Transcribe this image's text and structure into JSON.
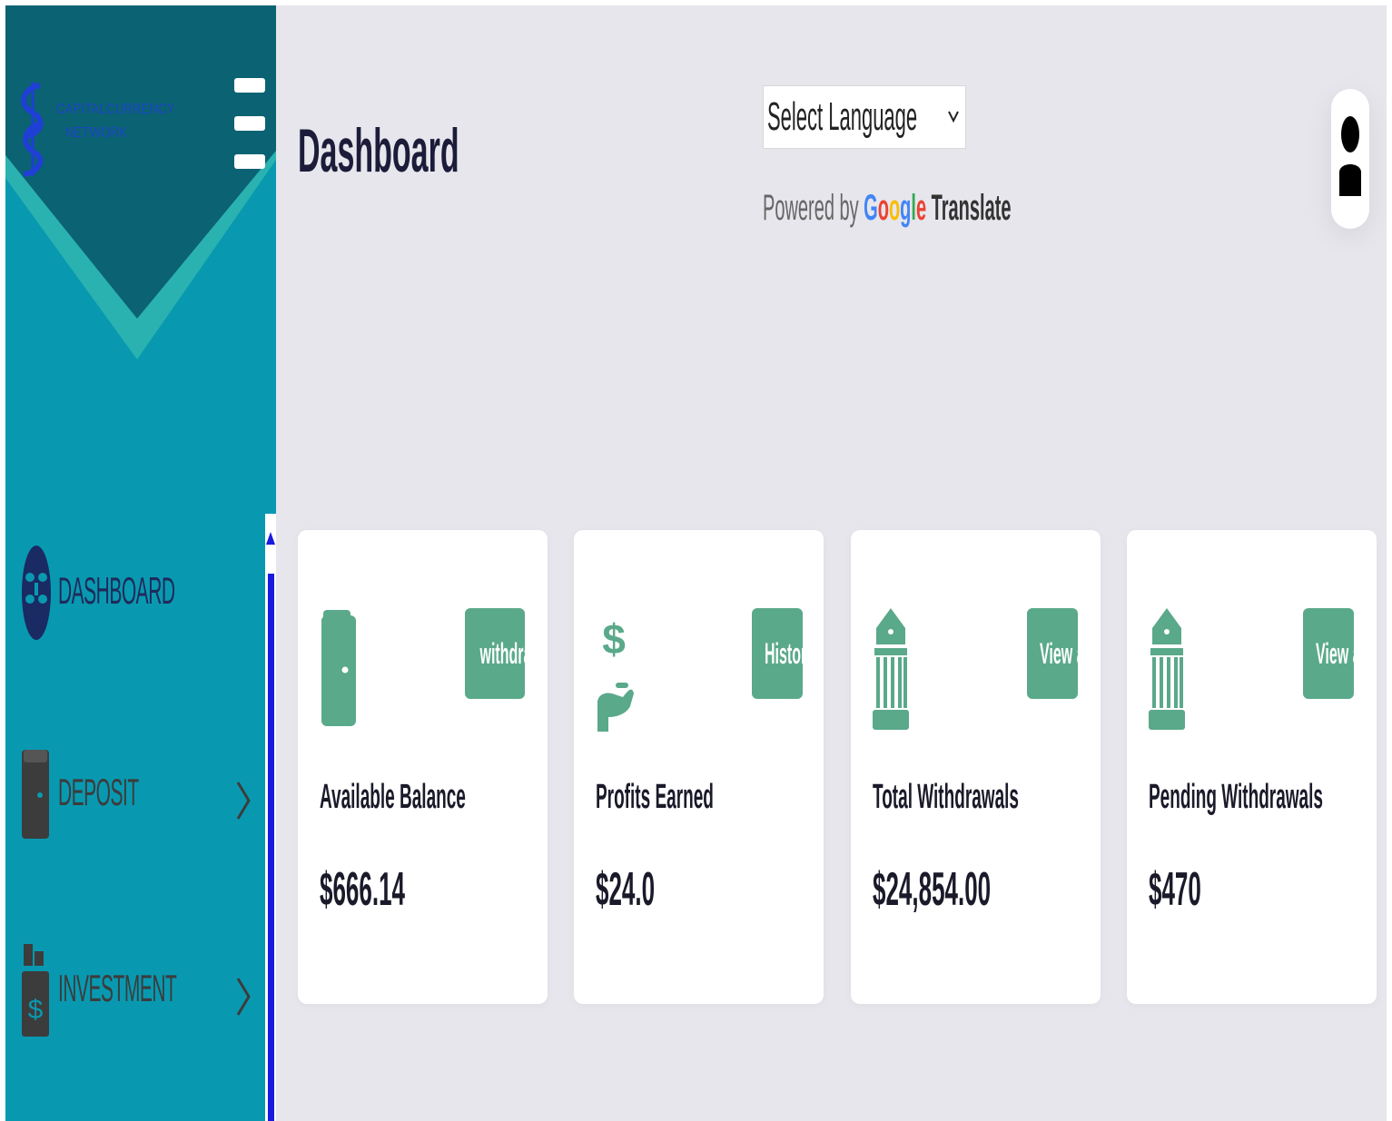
{
  "brand": {
    "logo_text": "CAPITALCURRENCY NETWORK",
    "colors": {
      "sidebar": "#0899b1",
      "sidebar_dark": "#0b6272",
      "accent_teal": "#2ab2b0",
      "button_green": "#5aa98a"
    }
  },
  "sidebar": {
    "menu_icon": "hamburger-icon",
    "items": [
      {
        "label": "DASHBOARD",
        "icon": "dashboard-icon",
        "label_color": "#1f2a5a"
      },
      {
        "label": "DEPOSIT",
        "icon": "wallet-icon",
        "label_color": "#3c3c3c"
      },
      {
        "label": "INVESTMENT",
        "icon": "investment-icon",
        "label_color": "#3c3c3c"
      }
    ]
  },
  "header": {
    "page_title": "Dashboard",
    "language_select": {
      "selected": "Select Language"
    },
    "powered_by": {
      "prefix": "Powered by",
      "brand_letters": [
        "G",
        "o",
        "o",
        "g",
        "l",
        "e"
      ],
      "suffix": "Translate"
    },
    "user_icon": "user-icon"
  },
  "cards": [
    {
      "label": "Available Balance",
      "value": "$666.14",
      "button": "withdraw",
      "icon": "wallet-icon"
    },
    {
      "label": "Profits Earned",
      "value": "$24.0",
      "button": "History",
      "icon": "hand-dollar-icon"
    },
    {
      "label": "Total Withdrawals",
      "value": "$24,854.00",
      "button": "View all",
      "icon": "bank-icon"
    },
    {
      "label": "Pending Withdrawals",
      "value": "$470",
      "button": "View all",
      "icon": "bank-icon"
    }
  ]
}
